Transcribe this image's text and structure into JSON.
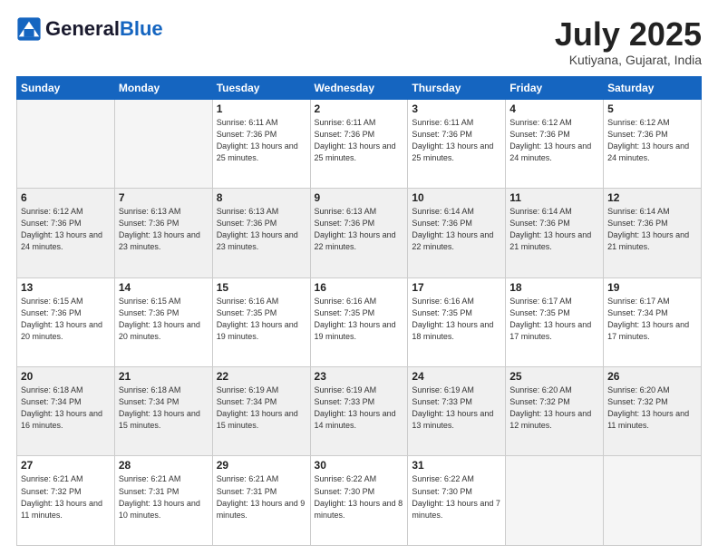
{
  "header": {
    "logo_general": "General",
    "logo_blue": "Blue",
    "month_title": "July 2025",
    "location": "Kutiyana, Gujarat, India"
  },
  "weekdays": [
    "Sunday",
    "Monday",
    "Tuesday",
    "Wednesday",
    "Thursday",
    "Friday",
    "Saturday"
  ],
  "weeks": [
    [
      {
        "day": "",
        "info": ""
      },
      {
        "day": "",
        "info": ""
      },
      {
        "day": "1",
        "info": "Sunrise: 6:11 AM\nSunset: 7:36 PM\nDaylight: 13 hours and 25 minutes."
      },
      {
        "day": "2",
        "info": "Sunrise: 6:11 AM\nSunset: 7:36 PM\nDaylight: 13 hours and 25 minutes."
      },
      {
        "day": "3",
        "info": "Sunrise: 6:11 AM\nSunset: 7:36 PM\nDaylight: 13 hours and 25 minutes."
      },
      {
        "day": "4",
        "info": "Sunrise: 6:12 AM\nSunset: 7:36 PM\nDaylight: 13 hours and 24 minutes."
      },
      {
        "day": "5",
        "info": "Sunrise: 6:12 AM\nSunset: 7:36 PM\nDaylight: 13 hours and 24 minutes."
      }
    ],
    [
      {
        "day": "6",
        "info": "Sunrise: 6:12 AM\nSunset: 7:36 PM\nDaylight: 13 hours and 24 minutes."
      },
      {
        "day": "7",
        "info": "Sunrise: 6:13 AM\nSunset: 7:36 PM\nDaylight: 13 hours and 23 minutes."
      },
      {
        "day": "8",
        "info": "Sunrise: 6:13 AM\nSunset: 7:36 PM\nDaylight: 13 hours and 23 minutes."
      },
      {
        "day": "9",
        "info": "Sunrise: 6:13 AM\nSunset: 7:36 PM\nDaylight: 13 hours and 22 minutes."
      },
      {
        "day": "10",
        "info": "Sunrise: 6:14 AM\nSunset: 7:36 PM\nDaylight: 13 hours and 22 minutes."
      },
      {
        "day": "11",
        "info": "Sunrise: 6:14 AM\nSunset: 7:36 PM\nDaylight: 13 hours and 21 minutes."
      },
      {
        "day": "12",
        "info": "Sunrise: 6:14 AM\nSunset: 7:36 PM\nDaylight: 13 hours and 21 minutes."
      }
    ],
    [
      {
        "day": "13",
        "info": "Sunrise: 6:15 AM\nSunset: 7:36 PM\nDaylight: 13 hours and 20 minutes."
      },
      {
        "day": "14",
        "info": "Sunrise: 6:15 AM\nSunset: 7:36 PM\nDaylight: 13 hours and 20 minutes."
      },
      {
        "day": "15",
        "info": "Sunrise: 6:16 AM\nSunset: 7:35 PM\nDaylight: 13 hours and 19 minutes."
      },
      {
        "day": "16",
        "info": "Sunrise: 6:16 AM\nSunset: 7:35 PM\nDaylight: 13 hours and 19 minutes."
      },
      {
        "day": "17",
        "info": "Sunrise: 6:16 AM\nSunset: 7:35 PM\nDaylight: 13 hours and 18 minutes."
      },
      {
        "day": "18",
        "info": "Sunrise: 6:17 AM\nSunset: 7:35 PM\nDaylight: 13 hours and 17 minutes."
      },
      {
        "day": "19",
        "info": "Sunrise: 6:17 AM\nSunset: 7:34 PM\nDaylight: 13 hours and 17 minutes."
      }
    ],
    [
      {
        "day": "20",
        "info": "Sunrise: 6:18 AM\nSunset: 7:34 PM\nDaylight: 13 hours and 16 minutes."
      },
      {
        "day": "21",
        "info": "Sunrise: 6:18 AM\nSunset: 7:34 PM\nDaylight: 13 hours and 15 minutes."
      },
      {
        "day": "22",
        "info": "Sunrise: 6:19 AM\nSunset: 7:34 PM\nDaylight: 13 hours and 15 minutes."
      },
      {
        "day": "23",
        "info": "Sunrise: 6:19 AM\nSunset: 7:33 PM\nDaylight: 13 hours and 14 minutes."
      },
      {
        "day": "24",
        "info": "Sunrise: 6:19 AM\nSunset: 7:33 PM\nDaylight: 13 hours and 13 minutes."
      },
      {
        "day": "25",
        "info": "Sunrise: 6:20 AM\nSunset: 7:32 PM\nDaylight: 13 hours and 12 minutes."
      },
      {
        "day": "26",
        "info": "Sunrise: 6:20 AM\nSunset: 7:32 PM\nDaylight: 13 hours and 11 minutes."
      }
    ],
    [
      {
        "day": "27",
        "info": "Sunrise: 6:21 AM\nSunset: 7:32 PM\nDaylight: 13 hours and 11 minutes."
      },
      {
        "day": "28",
        "info": "Sunrise: 6:21 AM\nSunset: 7:31 PM\nDaylight: 13 hours and 10 minutes."
      },
      {
        "day": "29",
        "info": "Sunrise: 6:21 AM\nSunset: 7:31 PM\nDaylight: 13 hours and 9 minutes."
      },
      {
        "day": "30",
        "info": "Sunrise: 6:22 AM\nSunset: 7:30 PM\nDaylight: 13 hours and 8 minutes."
      },
      {
        "day": "31",
        "info": "Sunrise: 6:22 AM\nSunset: 7:30 PM\nDaylight: 13 hours and 7 minutes."
      },
      {
        "day": "",
        "info": ""
      },
      {
        "day": "",
        "info": ""
      }
    ]
  ]
}
